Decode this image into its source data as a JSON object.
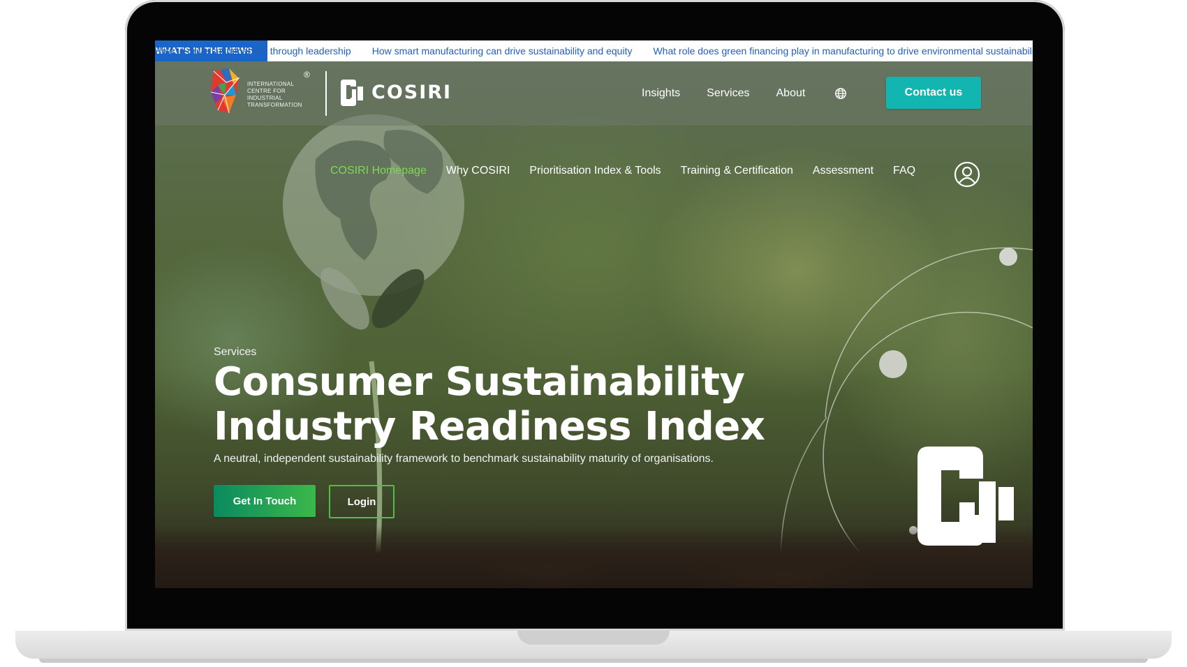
{
  "ticker": {
    "label": "WHAT'S IN THE NEWS",
    "items": [
      "How to drive sustainability through leadership",
      "How smart manufacturing can drive sustainability and equity",
      "What role does green financing play in manufacturing to drive environmental sustainability"
    ]
  },
  "header": {
    "org_logo_text": "INTERNATIONAL CENTRE FOR INDUSTRIAL TRANSFORMATION",
    "org_logo_mark": "®",
    "brand_name": "COSIRI",
    "nav": [
      "Insights",
      "Services",
      "About"
    ],
    "contact_label": "Contact us"
  },
  "sub_nav": {
    "items": [
      "COSIRI Homepage",
      "Why COSIRI",
      "Prioritisation Index & Tools",
      "Training & Certification",
      "Assessment",
      "FAQ"
    ],
    "active_index": 0
  },
  "hero": {
    "eyebrow": "Services",
    "title": "Consumer Sustainability Industry Readiness Index",
    "subtitle": "A neutral, independent sustainability framework to benchmark sustainability maturity of organisations.",
    "primary_button": "Get In Touch",
    "secondary_button": "Login"
  },
  "colors": {
    "ticker_label_bg": "#1a66c8",
    "ticker_text": "#1f5fbf",
    "contact_button_bg": "#12b5b0",
    "active_nav": "#7ed957",
    "primary_button_gradient": [
      "#0b8a5f",
      "#3bb84a"
    ],
    "secondary_button_border": "#4fbf4a"
  },
  "icons": [
    "globe-icon",
    "user-account-icon",
    "cosiri-logo-icon",
    "icit-logo-icon"
  ]
}
